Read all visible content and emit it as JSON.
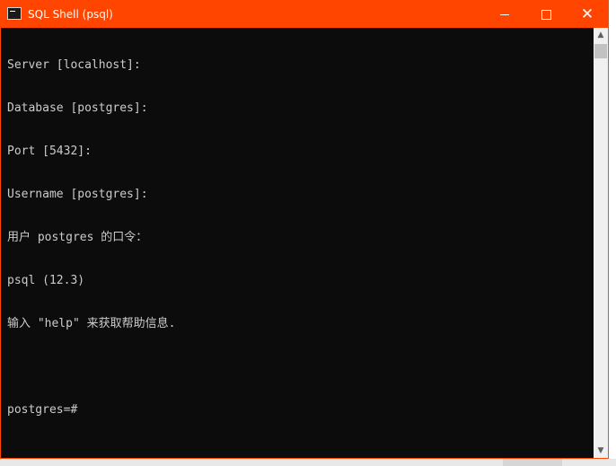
{
  "window": {
    "title": "SQL Shell (psql)",
    "accent_color": "#ff4500",
    "console_bg": "#0c0c0c",
    "console_fg": "#cccccc"
  },
  "console": {
    "lines": [
      "Server [localhost]:",
      "Database [postgres]:",
      "Port [5432]:",
      "Username [postgres]:",
      "用户 postgres 的口令：",
      "psql (12.3)",
      "输入 \"help\" 来获取帮助信息.",
      "",
      "postgres=#"
    ]
  },
  "icons": {
    "app": "terminal-icon",
    "minimize": "minimize-icon",
    "maximize": "maximize-icon",
    "close": "close-icon",
    "scroll_up": "chevron-up-icon",
    "scroll_down": "chevron-down-icon"
  }
}
